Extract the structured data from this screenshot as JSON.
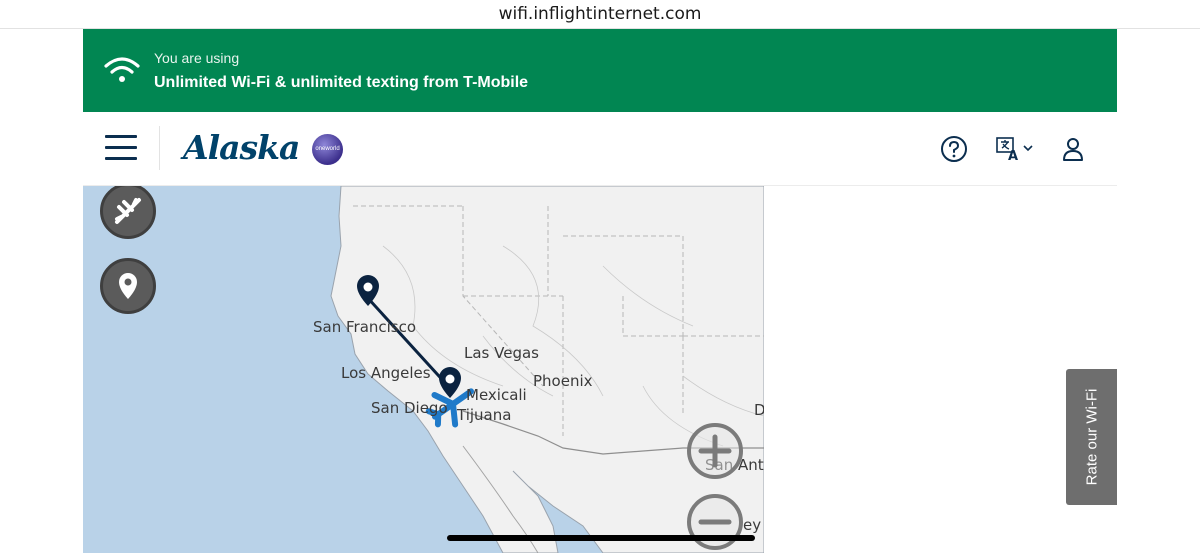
{
  "browser": {
    "url": "wifi.inflightinternet.com"
  },
  "banner": {
    "line1": "You are using",
    "line2": "Unlimited Wi-Fi & unlimited texting from T-Mobile",
    "color": "#018652",
    "icon": "wifi-icon"
  },
  "header": {
    "logo_text": "Alaska",
    "partner_badge": "oneworld",
    "icons": [
      "menu-icon",
      "help-icon",
      "language-icon",
      "user-icon"
    ]
  },
  "map": {
    "cities": {
      "san_francisco": "San Francisco",
      "las_vegas": "Las Vegas",
      "los_angeles": "Los Angeles",
      "mexicali": "Mexicali",
      "phoenix": "Phoenix",
      "san_diego": "San Diego",
      "tijuana": "Tijuana",
      "san_antonio": "San Ant",
      "d_partial": "D",
      "ey_partial": "ey"
    },
    "controls": [
      "flight-icon",
      "location-pin-icon",
      "zoom-in-icon",
      "zoom-out-icon"
    ],
    "route_color": "#0b2340",
    "plane_color": "#1f7ac9"
  },
  "feedback": {
    "label": "Rate our Wi-Fi"
  }
}
